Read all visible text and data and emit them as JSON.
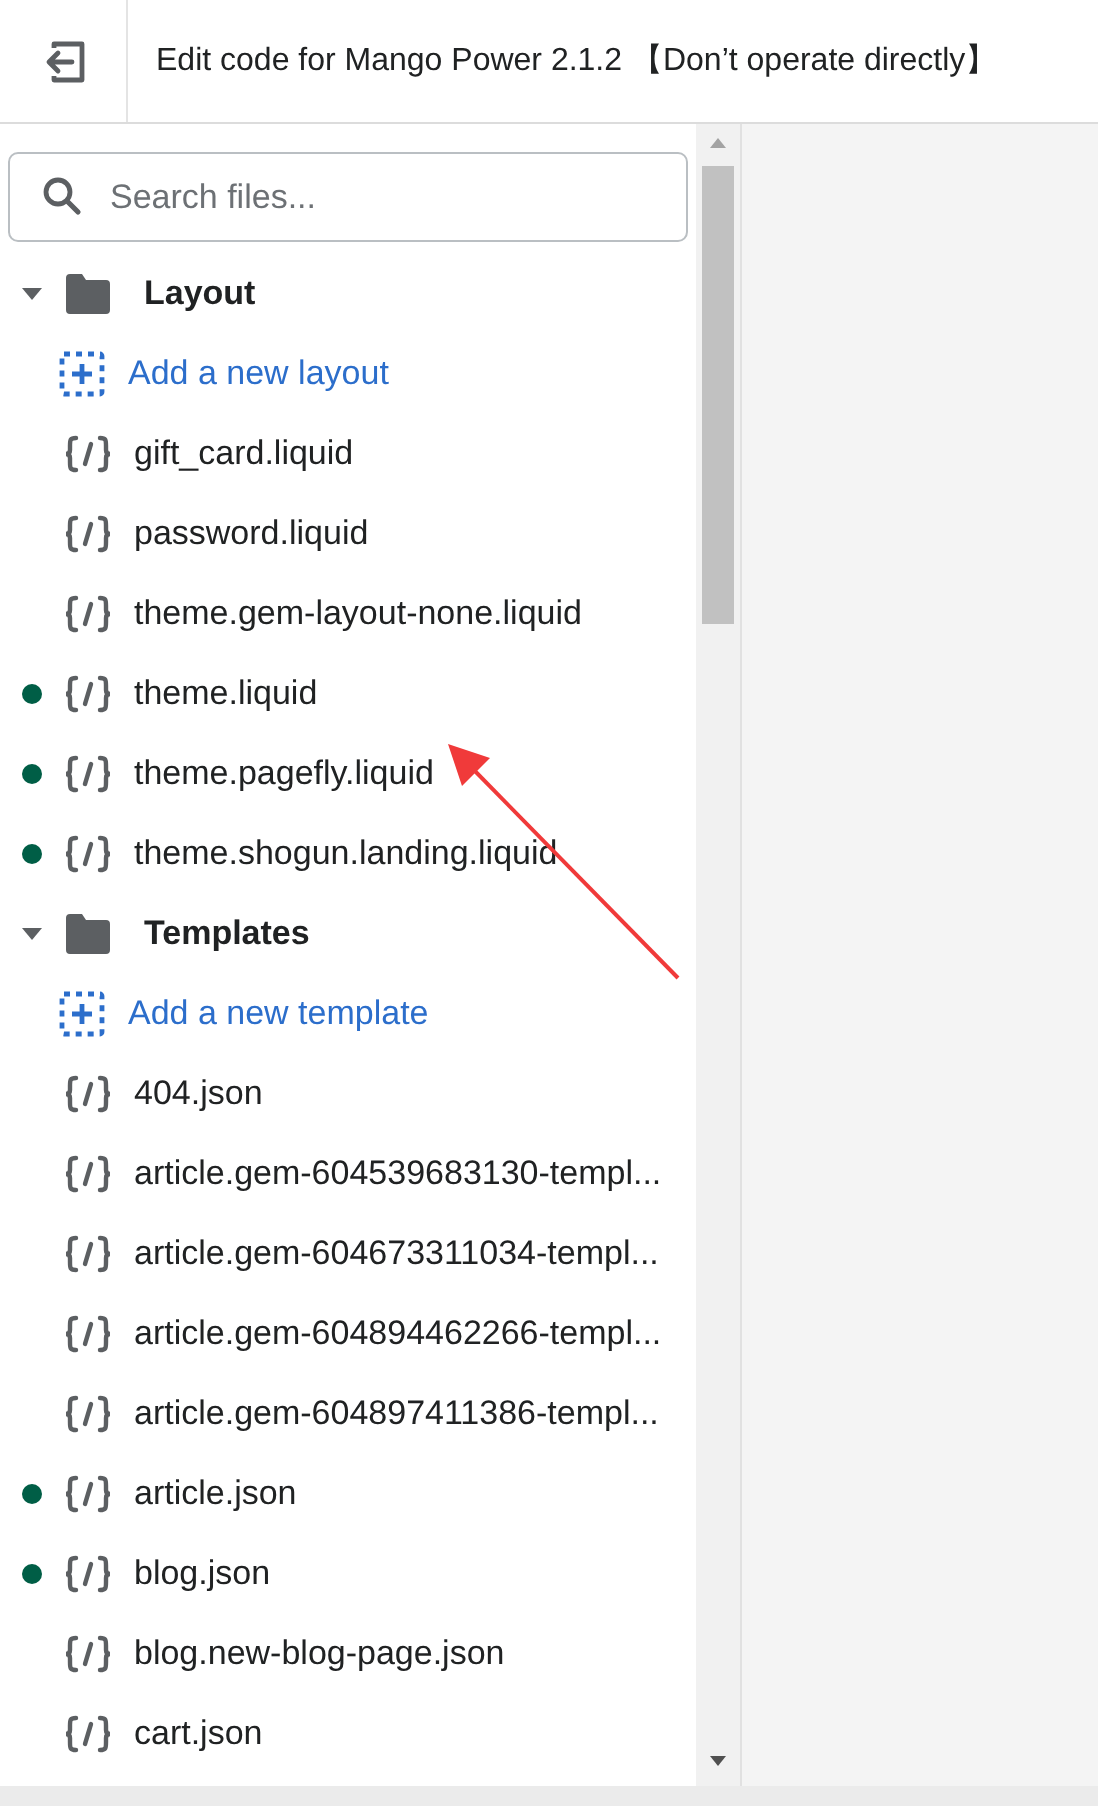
{
  "header": {
    "title": "Edit code for Mango Power 2.1.2 【Don’t operate directly】"
  },
  "search": {
    "placeholder": "Search files..."
  },
  "tree": [
    {
      "kind": "folder",
      "label": "Layout",
      "expanded": true,
      "children": [
        {
          "kind": "add",
          "label": "Add a new layout"
        },
        {
          "kind": "file",
          "label": "gift_card.liquid",
          "modified": false
        },
        {
          "kind": "file",
          "label": "password.liquid",
          "modified": false
        },
        {
          "kind": "file",
          "label": "theme.gem-layout-none.liquid",
          "modified": false
        },
        {
          "kind": "file",
          "label": "theme.liquid",
          "modified": true
        },
        {
          "kind": "file",
          "label": "theme.pagefly.liquid",
          "modified": true
        },
        {
          "kind": "file",
          "label": "theme.shogun.landing.liquid",
          "modified": true
        }
      ]
    },
    {
      "kind": "folder",
      "label": "Templates",
      "expanded": true,
      "children": [
        {
          "kind": "add",
          "label": "Add a new template"
        },
        {
          "kind": "file",
          "label": "404.json",
          "modified": false
        },
        {
          "kind": "file",
          "label": "article.gem-604539683130-templ...",
          "modified": false
        },
        {
          "kind": "file",
          "label": "article.gem-604673311034-templ...",
          "modified": false
        },
        {
          "kind": "file",
          "label": "article.gem-604894462266-templ...",
          "modified": false
        },
        {
          "kind": "file",
          "label": "article.gem-604897411386-templ...",
          "modified": false
        },
        {
          "kind": "file",
          "label": "article.json",
          "modified": true
        },
        {
          "kind": "file",
          "label": "blog.json",
          "modified": true
        },
        {
          "kind": "file",
          "label": "blog.new-blog-page.json",
          "modified": false
        },
        {
          "kind": "file",
          "label": "cart.json",
          "modified": false
        }
      ]
    }
  ]
}
